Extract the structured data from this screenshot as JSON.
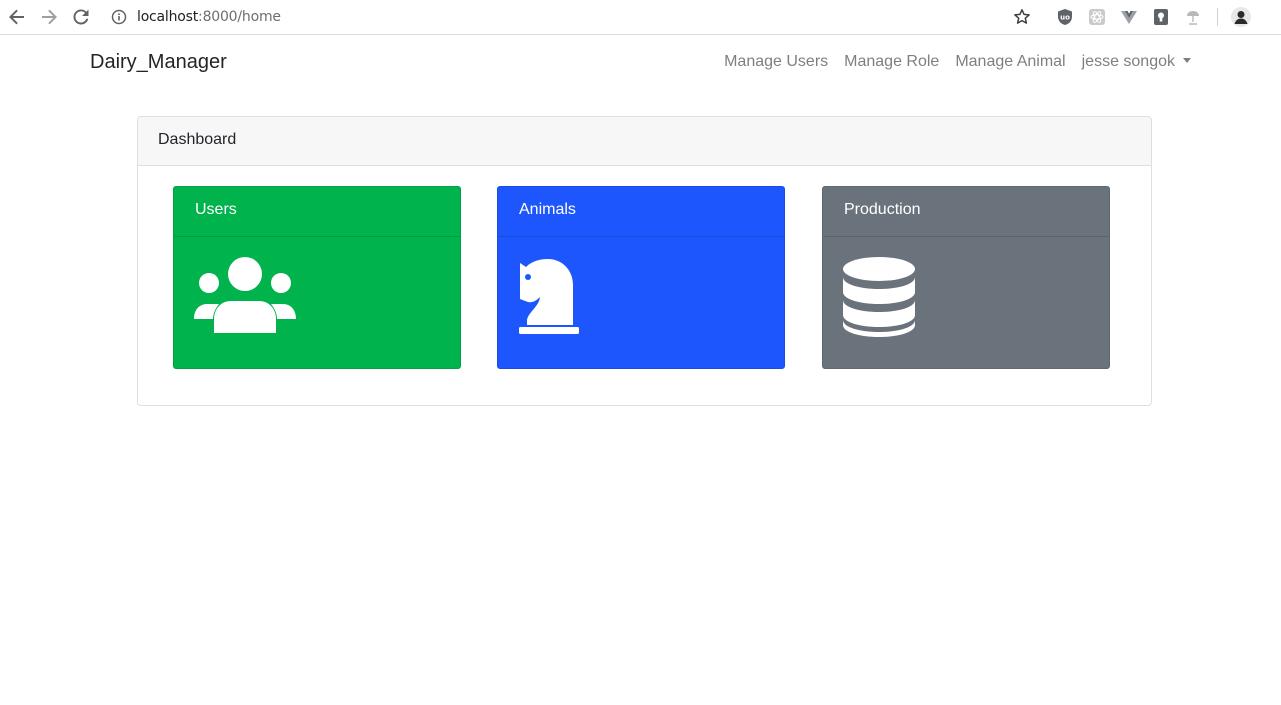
{
  "browser": {
    "url_host": "localhost",
    "url_rest": ":8000/home",
    "icons": [
      "back-arrow-icon",
      "forward-arrow-icon",
      "reload-icon",
      "site-info-icon",
      "bookmark-star-icon",
      "ublock-extension-icon",
      "react-devtools-extension-icon",
      "vue-devtools-extension-icon",
      "keep-extension-icon",
      "extension-icon",
      "profile-avatar-icon"
    ]
  },
  "navbar": {
    "brand": "Dairy_Manager",
    "links": [
      {
        "label": "Manage Users"
      },
      {
        "label": "Manage Role"
      },
      {
        "label": "Manage Animal"
      }
    ],
    "user": "jesse songok"
  },
  "dashboard": {
    "title": "Dashboard",
    "tiles": [
      {
        "label": "Users",
        "icon": "users-icon",
        "color": "#00b34c"
      },
      {
        "label": "Animals",
        "icon": "chess-knight-icon",
        "color": "#1e56fe"
      },
      {
        "label": "Production",
        "icon": "database-icon",
        "color": "#6a737c"
      }
    ]
  }
}
